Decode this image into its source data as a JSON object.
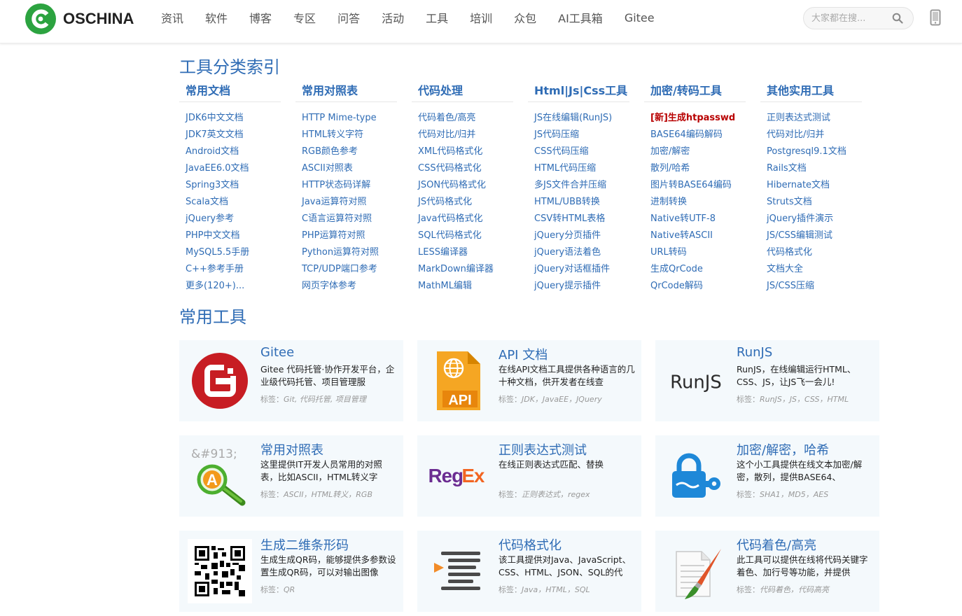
{
  "header": {
    "logo_text": "OSCHINA",
    "nav": [
      "资讯",
      "软件",
      "博客",
      "专区",
      "问答",
      "活动",
      "工具",
      "培训",
      "众包",
      "AI工具箱",
      "Gitee"
    ],
    "search_placeholder": "大家都在搜..."
  },
  "index_title": "工具分类索引",
  "categories": [
    {
      "title": "常用文档",
      "items": [
        "JDK6中文文档",
        "JDK7英文文档",
        "Android文档",
        "JavaEE6.0文档",
        "Spring3文档",
        "Scala文档",
        "jQuery参考",
        "PHP中文文档",
        "MySQL5.5手册",
        "C++参考手册",
        "更多(120+)..."
      ]
    },
    {
      "title": "常用对照表",
      "items": [
        "HTTP Mime-type",
        "HTML转义字符",
        "RGB颜色参考",
        "ASCII对照表",
        "HTTP状态码详解",
        "Java运算符对照",
        "C语言运算符对照",
        "PHP运算符对照",
        "Python运算符对照",
        "TCP/UDP端口参考",
        "网页字体参考"
      ]
    },
    {
      "title": "代码处理",
      "items": [
        "代码着色/高亮",
        "代码对比/归并",
        "XML代码格式化",
        "CSS代码格式化",
        "JSON代码格式化",
        "JS代码格式化",
        "Java代码格式化",
        "SQL代码格式化",
        "LESS编译器",
        "MarkDown编译器",
        "MathML编辑"
      ]
    },
    {
      "title": "Html|Js|Css工具",
      "items": [
        "JS在线编辑(RunJS)",
        "JS代码压缩",
        "CSS代码压缩",
        "HTML代码压缩",
        "多JS文件合并压缩",
        "HTML/UBB转换",
        "CSV转HTML表格",
        "jQuery分页插件",
        "jQuery语法着色",
        "jQuery对话框插件",
        "jQuery提示插件"
      ]
    },
    {
      "title": "加密/转码工具",
      "hot": "[新]生成htpasswd",
      "items": [
        "BASE64编码解码",
        "加密/解密",
        "散列/哈希",
        "图片转BASE64编码",
        "进制转换",
        "Native转UTF-8",
        "Native转ASCII",
        "URL转码",
        "生成QrCode",
        "QrCode解码"
      ]
    },
    {
      "title": "其他实用工具",
      "items": [
        "正则表达式测试",
        "代码对比/归并",
        "Postgresql9.1文档",
        "Rails文档",
        "Hibernate文档",
        "Struts文档",
        "jQuery插件演示",
        "JS/CSS编辑测试",
        "代码格式化",
        "文档大全",
        "JS/CSS压缩"
      ]
    }
  ],
  "tools_title": "常用工具",
  "tag_label": "标签：",
  "tools": [
    {
      "icon": "gitee-logo-icon",
      "title": "Gitee",
      "desc": "Gitee 代码托管·协作开发平台，企业级代码托管、项目管理服",
      "tags": "Git, 代码托管, 项目管理"
    },
    {
      "icon": "api-doc-icon",
      "title": "API 文档",
      "desc": "在线API文档工具提供各种语言的几十种文档，供开发者在线查",
      "tags": "JDK，JavaEE，JQuery",
      "icon_text": "API"
    },
    {
      "icon": "runjs-logo-icon",
      "title": "RunJS",
      "desc": "RunJS，在线编辑运行HTML、CSS、JS，让JS飞一会儿!",
      "tags": "RunJS，JS，CSS，HTML",
      "icon_text": "RunJS"
    },
    {
      "icon": "magnifier-a-icon",
      "title": "常用对照表",
      "desc": "这里提供IT开发人员常用的对照表，比如ASCII，HTML转义字",
      "tags": "ASCII，HTML转义，RGB",
      "icon_text": "&#913;",
      "icon_letter": "A"
    },
    {
      "icon": "regex-logo-icon",
      "title": "正则表达式测试",
      "desc": "在线正则表达式匹配、替换",
      "tags": "正则表达式，regex",
      "icon_text": "Reg",
      "icon_text2": "Ex"
    },
    {
      "icon": "padlock-key-icon",
      "title": "加密/解密，哈希",
      "desc": "这个小工具提供在线文本加密/解密，散列，提供BASE64、",
      "tags": "SHA1，MD5，AES"
    },
    {
      "icon": "qrcode-icon",
      "title": "生成二维条形码",
      "desc": "生成生成QR码，能够提供多参数设置生成QR码，可以对输出图像",
      "tags": "QR"
    },
    {
      "icon": "code-format-icon",
      "title": "代码格式化",
      "desc": "该工具提供对Java、JavaScript、CSS、HTML、JSON、SQL的代",
      "tags": "Java，HTML，SQL"
    },
    {
      "icon": "paintbrush-doc-icon",
      "title": "代码着色/高亮",
      "desc": "此工具可以提供在线将代码关键字着色、加行号等功能，并提供",
      "tags": "代码着色，代码高亮"
    }
  ],
  "colors": {
    "brand_green": "#2ca340",
    "link_blue": "#2f6cb5",
    "hot_red": "#b80000",
    "card_bg": "#f4f9fc"
  }
}
